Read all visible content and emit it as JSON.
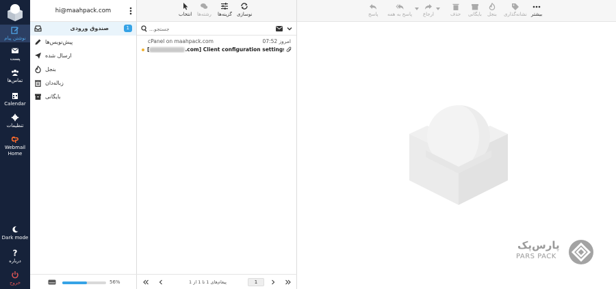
{
  "nav": {
    "compose_label": "نوشتن پیام",
    "mail_label": "پست",
    "contacts_label": "تماس‌ها",
    "calendar_label": "Calendar",
    "settings_label": "تنظیمات",
    "webmail_label_1": "Webmail",
    "webmail_label_2": "Home",
    "darkmode_label": "Dark mode",
    "about_label": "درباره",
    "logout_label": "خروج"
  },
  "account": {
    "email": "hi@maahpack.com"
  },
  "folders": [
    {
      "name": "صندوق ورودی",
      "unread": "1"
    },
    {
      "name": "پیش‌نویس‌ها"
    },
    {
      "name": "ارسال شده"
    },
    {
      "name": "بنجل"
    },
    {
      "name": "زباله‌دان"
    },
    {
      "name": "بایگانی"
    }
  ],
  "quota": {
    "percent_label": "56%",
    "fraction": 0.56
  },
  "list_toolbar": {
    "select_label": "انتخاب",
    "options_label": "گزینه‌ها",
    "threads_label": "رشته‌ها",
    "refresh_label": "نوسازی"
  },
  "search": {
    "placeholder": "...جستجو"
  },
  "messages": [
    {
      "from": "cPanel on maahpack.com",
      "date": "امروز 07:52",
      "subject_prefix": "[",
      "subject_rest": ".com] Client configuration settings for \"hi@..."
    }
  ],
  "pager": {
    "count_label": "پیغام‌های 1 تا 1 از 1",
    "page": "1"
  },
  "mail_toolbar": {
    "reply_label": "پاسخ",
    "reply_all_label": "پاسخ به همه",
    "forward_label": "ارجاع",
    "delete_label": "حذف",
    "archive_label": "بایگانی",
    "junk_label": "بنجل",
    "mark_label": "نشانه‌گذاری",
    "more_label": "بیشتر"
  },
  "brand": {
    "name_fa": "پارس‌پک",
    "name_en": "PARS PACK"
  },
  "colors": {
    "accent": "#36a3e6",
    "nav_bg": "#16223a",
    "unread_dot": "#f2b330"
  }
}
